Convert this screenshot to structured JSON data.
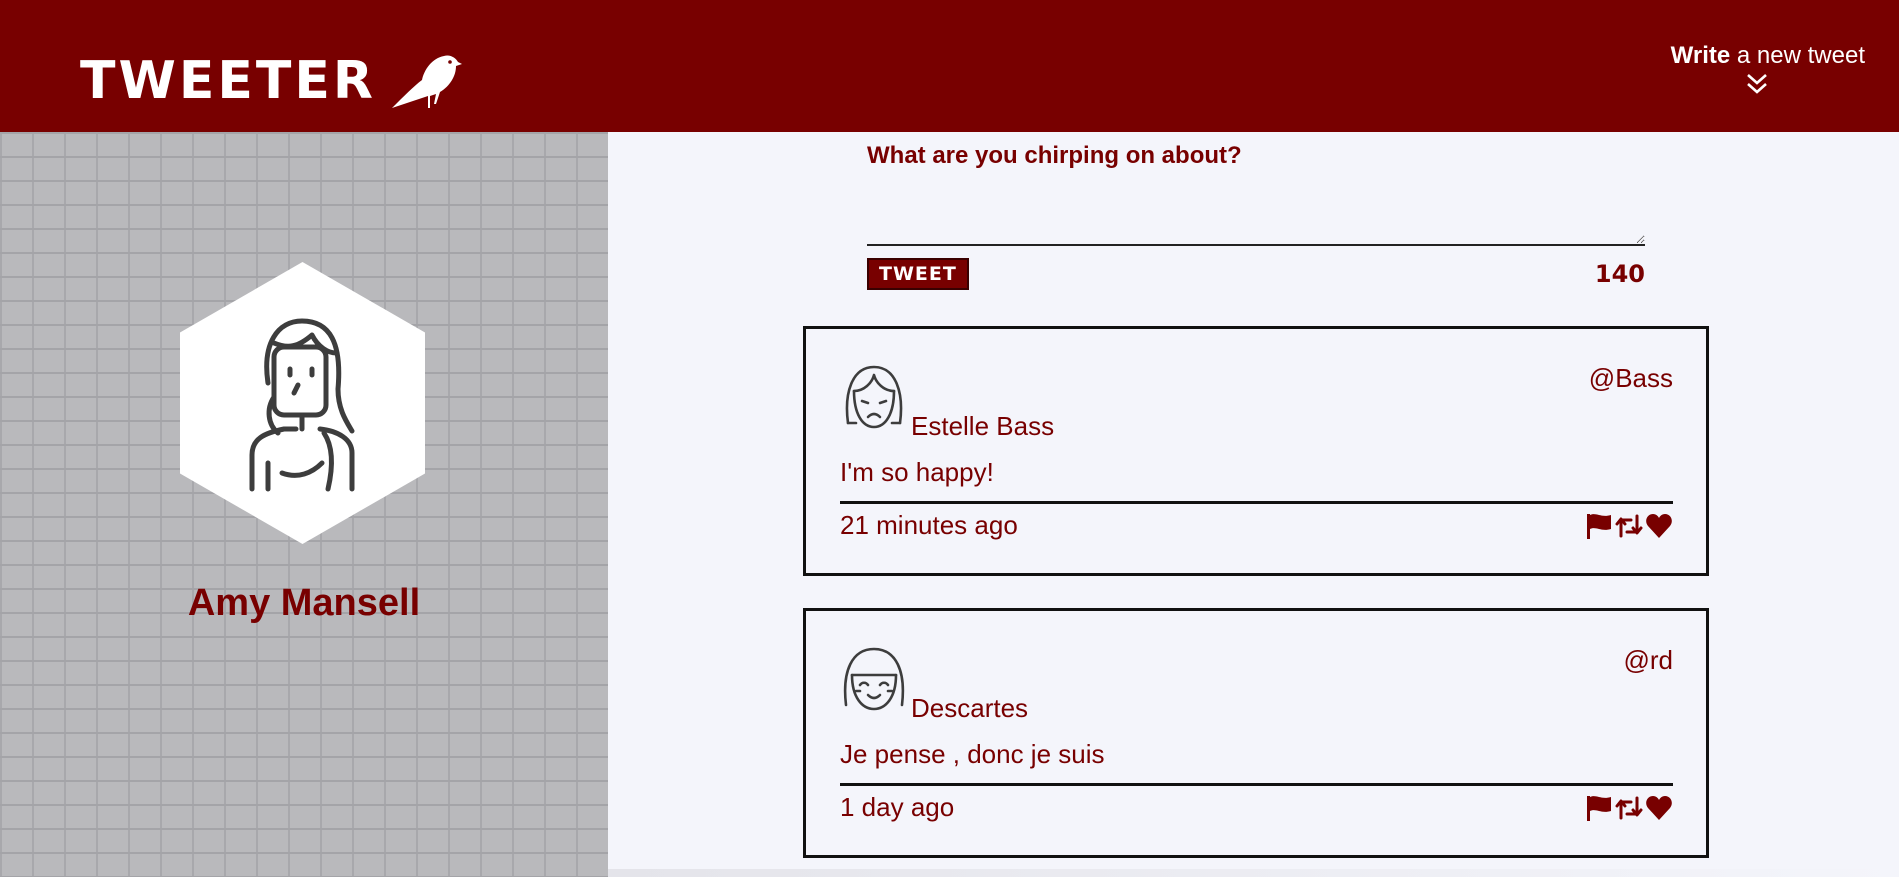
{
  "nav": {
    "logo_text": "TWEETER",
    "compose_toggle": {
      "strong": "Write",
      "rest": " a new tweet"
    }
  },
  "profile": {
    "name": "Amy Mansell"
  },
  "composer": {
    "label": "What are you chirping on about?",
    "input_value": "",
    "button_label": "TWEET",
    "counter": "140"
  },
  "tweets": [
    {
      "name": "Estelle Bass",
      "handle": "@Bass",
      "content": "I'm so happy!",
      "time": "21 minutes ago",
      "avatar_icon": "sad-girl-avatar-icon"
    },
    {
      "name": "Descartes",
      "handle": "@rd",
      "content": "Je pense , donc je suis",
      "time": "1 day ago",
      "avatar_icon": "smiling-girl-avatar-icon"
    }
  ],
  "icons": {
    "flag": "flag-icon",
    "retweet": "retweet-icon",
    "like": "heart-icon",
    "scroll": "double-chevron-down-icon"
  },
  "colors": {
    "brand": "#780000",
    "background": "#f4f5fb",
    "text_on_brand": "#ffffff"
  }
}
